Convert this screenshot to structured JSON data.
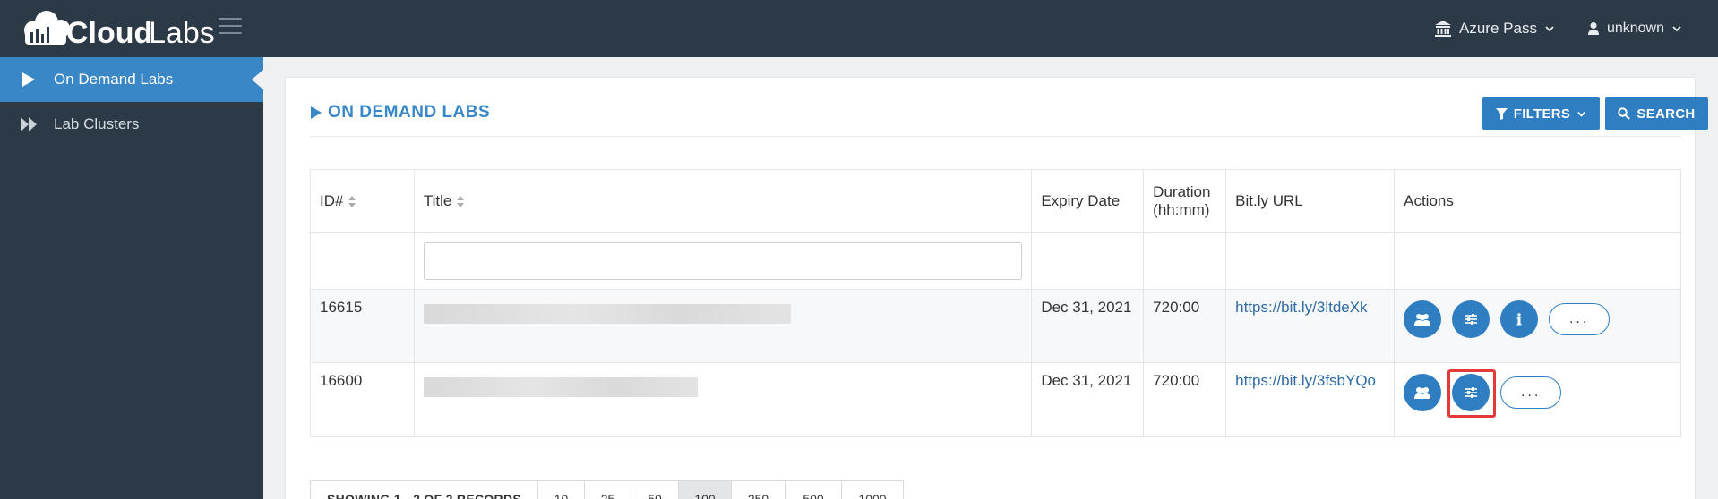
{
  "app": {
    "logo_text": "CloudLabs"
  },
  "topbar": {
    "org_label": "Azure Pass",
    "user_label": "unknown"
  },
  "sidebar": {
    "items": [
      {
        "label": "On Demand Labs",
        "icon": "play-icon",
        "active": true
      },
      {
        "label": "Lab Clusters",
        "icon": "fast-forward-icon",
        "active": false
      }
    ]
  },
  "page": {
    "title": "ON DEMAND LABS",
    "filters_label": "FILTERS",
    "search_label": "SEARCH"
  },
  "table": {
    "headers": {
      "id": "ID#",
      "title": "Title",
      "expiry": "Expiry Date",
      "duration_1": "Duration",
      "duration_2": "(hh:mm)",
      "bitly": "Bit.ly URL",
      "actions": "Actions"
    },
    "rows": [
      {
        "id": "16615",
        "title": "",
        "expiry": "Dec 31, 2021",
        "duration": "720:00",
        "url": "https://bit.ly/3ltdeXk"
      },
      {
        "id": "16600",
        "title": "",
        "expiry": "Dec 31, 2021",
        "duration": "720:00",
        "url": "https://bit.ly/3fsbYQo"
      }
    ],
    "more_label": "..."
  },
  "pagination": {
    "info": "SHOWING 1 - 2 OF 2 RECORDS",
    "sizes": [
      "10",
      "25",
      "50",
      "100",
      "250",
      "500",
      "1000"
    ],
    "selected": "100"
  },
  "colors": {
    "accent": "#2f7ec1",
    "sidebar_bg": "#2c3a47",
    "active_bg": "#3a87c8",
    "highlight": "#e23a3a"
  }
}
